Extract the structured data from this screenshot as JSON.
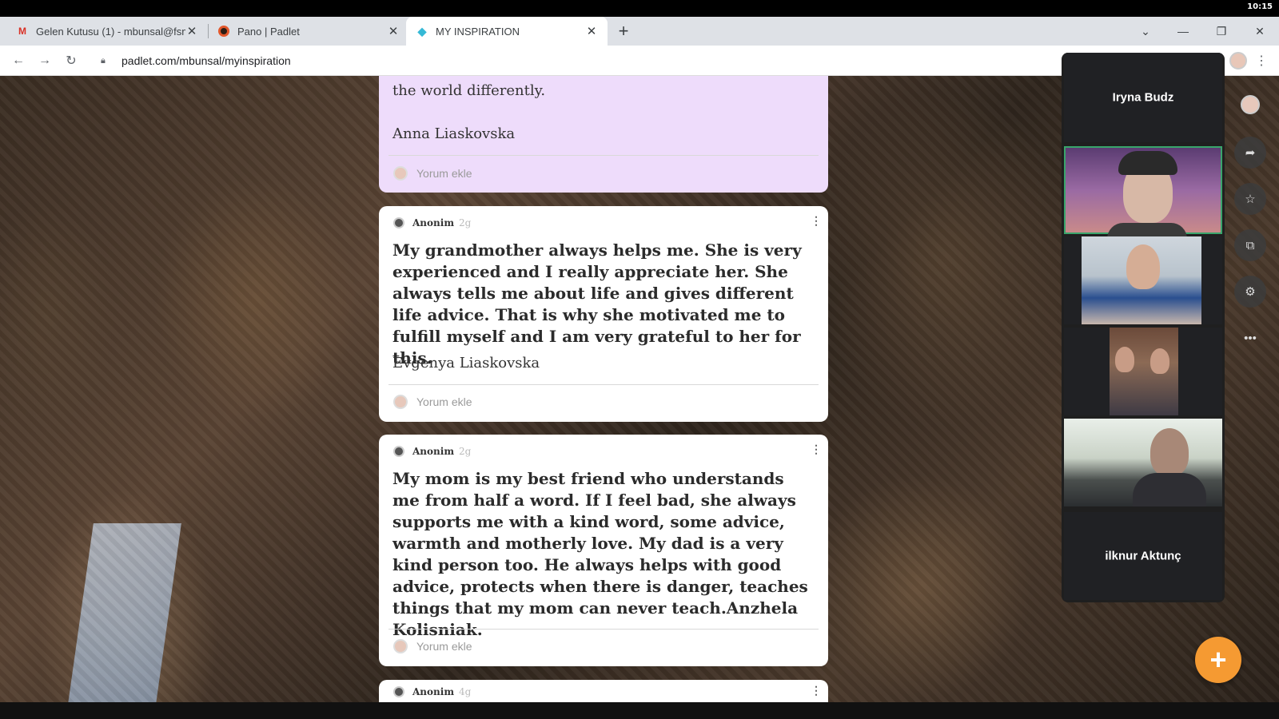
{
  "clock": "10:15",
  "tabs": [
    {
      "title": "Gelen Kutusu (1) - mbunsal@fsm",
      "favicon": "gmail-icon"
    },
    {
      "title": "Pano | Padlet",
      "favicon": "padlet-icon"
    },
    {
      "title": "MY INSPIRATION",
      "favicon": "padlet-diamond-icon",
      "active": true
    }
  ],
  "address_bar": {
    "url": "padlet.com/mbunsal/myinspiration"
  },
  "cards": [
    {
      "text_top": "the world differently.",
      "signature": "Anna Liaskovska",
      "comment_label": "Yorum ekle"
    },
    {
      "author": "Anonim",
      "ago": "2g",
      "body": "My grandmother always helps me. She is very experienced and I really appreciate her. She always tells me about life and gives different life advice. That is why she motivated me to fulfill myself and I am very grateful to her for this.",
      "signature": "Evgenya Liaskovska",
      "comment_label": "Yorum ekle"
    },
    {
      "author": "Anonim",
      "ago": "2g",
      "body": "My mom is my best friend who understands me from half a word. If I feel bad, she always supports me with a kind word, some advice, warmth and motherly love. My dad is a very kind person too. He always helps with good advice, protects when there is danger, teaches things that my mom can never teach.Anzhela Kolisniak.",
      "comment_label": "Yorum ekle"
    },
    {
      "author": "Anonim",
      "ago": "4g"
    }
  ],
  "meet": {
    "participants": [
      {
        "name": "Iryna Budz"
      },
      {
        "name": "ilknur Aktunç"
      }
    ]
  },
  "colors": {
    "fab": "#f59a32",
    "purple_card": "#eedcfb",
    "active_speaker": "#39a56b"
  }
}
